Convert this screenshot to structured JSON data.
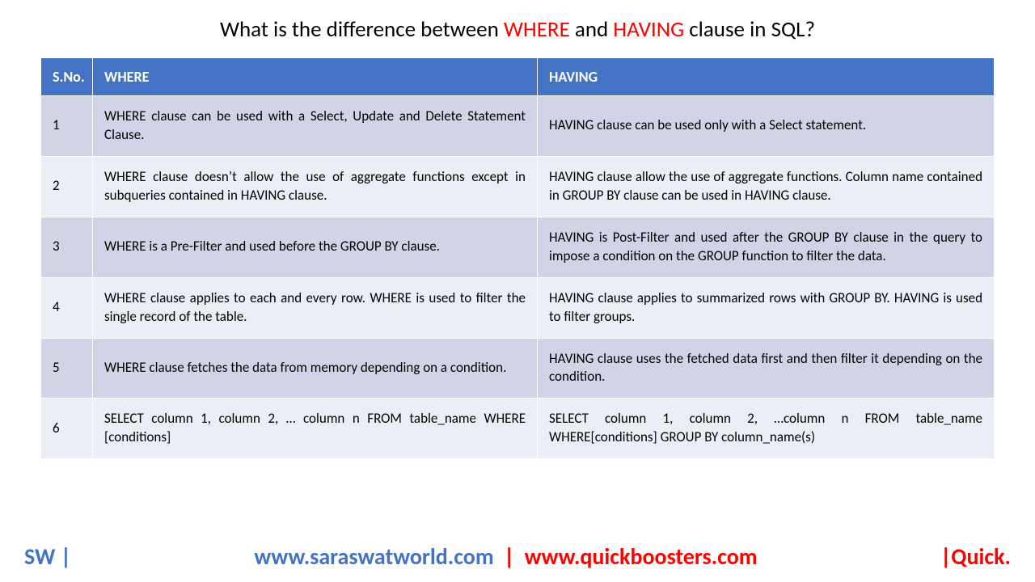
{
  "title": {
    "prefix": "What is the difference between ",
    "kw1": "WHERE",
    "mid": " and ",
    "kw2": "HAVING",
    "suffix": " clause in SQL?",
    "kw_color": "#ff0000"
  },
  "headers": {
    "sno": "S.No.",
    "where": "WHERE",
    "having": "HAVING"
  },
  "rows": [
    {
      "n": "1",
      "where": "WHERE clause can be used with a Select, Update and Delete Statement Clause.",
      "having": "HAVING clause can be used only with a Select statement."
    },
    {
      "n": "2",
      "where": "WHERE clause doesn’t allow the use of aggregate functions except in subqueries contained in HAVING clause.",
      "having": "HAVING clause allow the use of aggregate functions. Column name contained in GROUP BY clause can be used in HAVING clause."
    },
    {
      "n": "3",
      "where": "WHERE is a Pre-Filter and used before the GROUP BY clause.",
      "having": "HAVING is Post-Filter and used after the GROUP BY clause in the query to impose a condition on the GROUP function to filter the data."
    },
    {
      "n": "4",
      "where": "WHERE clause applies to each and every row. WHERE is used to filter the single record of the table.",
      "having": "HAVING clause applies to summarized rows with GROUP BY. HAVING is used to filter groups."
    },
    {
      "n": "5",
      "where": "WHERE clause fetches the data from memory depending on a condition.",
      "having": "HAVING clause uses the fetched data first and then filter it depending on the condition."
    },
    {
      "n": "6",
      "where": "SELECT column 1, column 2, … column n FROM table_name  WHERE [conditions]",
      "having": "SELECT column 1, column 2, …column n FROM table_name WHERE[conditions]  GROUP BY column_name(s)"
    }
  ],
  "footer": {
    "left": "SW |",
    "mid1": "www.saraswatworld.com",
    "sep": " | ",
    "mid2": "www.quickboosters.com",
    "right": "|Quick."
  }
}
